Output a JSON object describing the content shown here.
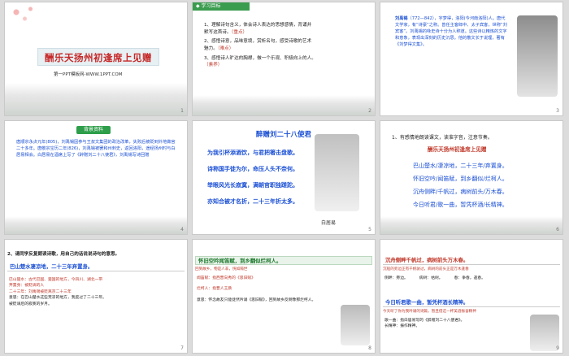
{
  "slides": [
    {
      "num": "1",
      "title": "酬乐天扬州初逢席上见赠",
      "subtitle": "第一PPT模板网-WWW.1PPT.COM",
      "pageno": "ppt"
    },
    {
      "num": "2",
      "header": "学习目标",
      "lines": [
        "1、理解诗句含义，体会诗人表达的思想感情，背诵并",
        "默写这首诗。",
        "（重点）",
        "2、感悟诗意，品味意境，赏析名句，感受诗歌的艺术",
        "魅力。",
        "（难点）",
        "3、感悟诗人旷达的胸襟，做一个乐观、积极向上的人。",
        "（素养）"
      ]
    },
    {
      "num": "3",
      "name_label": "刘禹锡",
      "text": "（772—842），字梦得，洛阳(今河南洛阳)人。唐代文学家，有“诗豪”之称。曾任主客郎中、太子宾客，世称“刘宾客”。刘禹锡的咏史诗十分为人称道。",
      "text2": "这些诗以精炼的文字和意象，表现出深刻的历史沉思。他的散文长于说理，著有《刘梦得文集》。"
    },
    {
      "num": "4",
      "tag": "背景资料",
      "text": "唐顺宗永贞元年(805)，刘禹锡因参与王叔文集团的政治改革，失败后被贬到外地做官二十多年。唐敬宗宝历二年(826)，刘禹锡被罢和州刺史，返回洛阳，途经扬州时与白居易相会。白居易在酒席上写了《醉赠刘二十八使君》，刘禹锡写诗回赠"
    },
    {
      "num": "5",
      "poem_title": "醉赠刘二十八使君",
      "lines": [
        "为我引杯添酒饮，与君把箸击盘歌。",
        "诗称国手徒为尔，命压人头不奈何。",
        "举眼风光长寂寞，满朝官职独蹉跎。",
        "亦知合被才名折，二十三年折太多。"
      ],
      "author": "白居易"
    },
    {
      "num": "6",
      "instruction": "1、有感情地朗读课文，读准字音，注意节奏。",
      "title": "酬乐天扬州初逢席上见赠",
      "lines": [
        "巴山楚水/凄凉地，二十三年/弃置身。",
        "怀旧空吟/闻笛赋，到乡翻似/烂柯人。",
        "沉舟侧畔/千帆过，病树前头/万木春。",
        "今日听君/歌一曲，暂凭杯酒/长精神。"
      ]
    },
    {
      "num": "7",
      "question": "2、请同学反复朗读诗歌，用自己的话说说诗句的意思。",
      "banner": "巴山楚水凄凉地，二十三年弃置身。",
      "notes": [
        "巴山楚水：古代巴国、楚国的地方，今四川、湖北一带",
        "弃置身：被贬谪的人",
        "二十三年：刘禹锡被贬离京二十三年"
      ],
      "lines": [
        "意思：在巴山楚水这些荒凉的地方，我度过了二十三年。",
        "被贬谪后的寂寞的岁月。"
      ]
    },
    {
      "num": "8",
      "banner": "怀旧空吟闻笛赋，到乡翻似烂柯人。",
      "sub": "回到故乡，物是人非，恍如隔世",
      "notes": [
        "闻笛赋：指西晋向秀的《思旧赋》",
        "烂柯人：指晋人王质",
        "意思：怀念故友只能徒然吟诵《思旧赋》，回到故乡反倒像那烂柯人。"
      ]
    },
    {
      "num": "9",
      "banner1": "沉舟侧畔千帆过，病树前头万木春。",
      "sub1": "沉船的旁边正有千帆驶过，病树的前头正是万木逢春",
      "words1": [
        "侧畔：旁边。",
        "病树：枯树。",
        "春：争春，逢春。"
      ],
      "banner2": "今日听君歌一曲，暂凭杯酒长精神。",
      "sub2": "今天听了你为我吟诵的诗篇，暂且借这一杯美酒振奋精神",
      "words2": [
        "歌一曲：指白居易写的《醉赠刘二十八使君》。",
        "长精神：振作精神。"
      ]
    }
  ]
}
